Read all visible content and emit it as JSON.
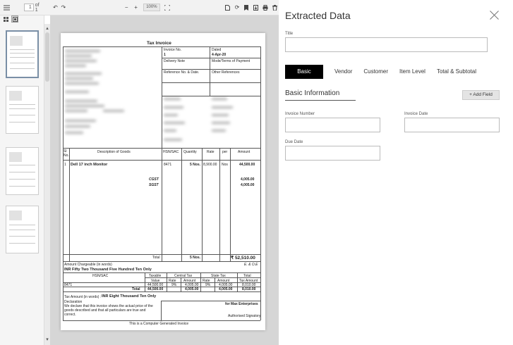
{
  "toolbar": {
    "page_current": "1",
    "page_total_text": "of 1",
    "zoom": "100%"
  },
  "document": {
    "title": "Tax Invoice",
    "header_labels": {
      "invoice_no": "Invoice No.",
      "dated": "Dated",
      "delivery_note": "Delivery Note",
      "mode_terms": "Mode/Terms of Payment",
      "reference": "Reference No. & Date.",
      "other_refs": "Other References"
    },
    "header_values": {
      "invoice_no": "1",
      "dated": "4-Apr-20"
    },
    "table": {
      "headers": [
        "Sl No.",
        "Description of Goods",
        "HSN/SAC",
        "Quantity",
        "Rate",
        "per",
        "Amount"
      ],
      "item": {
        "sl": "1",
        "description": "Dell 17 inch Monitor",
        "hsn": "8471",
        "quantity": "5 Nos.",
        "rate": "8,900.00",
        "per": "Nos",
        "amount": "44,500.00"
      },
      "cgst_label": "CGST",
      "sgst_label": "SGST",
      "cgst_amount": "4,005.00",
      "sgst_amount": "4,005.00",
      "total_label": "Total",
      "total_qty": "5 Nos.",
      "total_amount": "₹ 52,510.00"
    },
    "amount_words_label": "Amount Chargeable (in words)",
    "eoe": "E. & O.E",
    "amount_words": "INR Fifty Two Thousand Five Hundred Ten Only",
    "tax_table": {
      "hsn_label": "HSN/SAC",
      "taxable_label": "Taxable",
      "value_label": "Value",
      "central_tax": "Central Tax",
      "state_tax": "State Tax",
      "total_label": "Total",
      "tax_amount": "Tax Amount",
      "rate": "Rate",
      "amount": "Amount",
      "row": {
        "hsn": "8471",
        "value": "44,500.00",
        "c_rate": "9%",
        "c_amount": "4,005.00",
        "s_rate": "9%",
        "s_amount": "4,005.00",
        "total": "8,010.00"
      },
      "total_row": {
        "label": "Total",
        "value": "44,500.00",
        "c_amount": "4,005.00",
        "s_amount": "4,005.00",
        "total": "8,010.00"
      }
    },
    "tax_words_label": "Tax Amount (in words) :",
    "tax_words": "INR Eight Thousand Ten Only",
    "declaration_label": "Declaration",
    "declaration_text_1": "We declare that this invoice shows the actual price of the",
    "declaration_text_2": "goods described and that all particulars are true and",
    "declaration_text_3": "correct.",
    "for_company": "for Max Enterprises",
    "signatory": "Authorised Signatory",
    "footer": "This is a Computer Generated Invoice"
  },
  "panel": {
    "title": "Extracted Data",
    "title_field_label": "Title",
    "tabs": [
      "Basic",
      "Vendor",
      "Customer",
      "Item Level",
      "Total & Subtotal"
    ],
    "section_title": "Basic Information",
    "add_field": "Add Field",
    "fields": {
      "invoice_number": "Invoice Number",
      "invoice_date": "Invoice Date",
      "due_date": "Due Date"
    }
  },
  "icons": [
    "menu-icon",
    "undo-icon",
    "redo-icon",
    "zoom-out-icon",
    "zoom-in-icon",
    "fullscreen-icon",
    "file-icon",
    "rotate-icon",
    "bookmark-icon",
    "export-icon",
    "print-icon",
    "trash-icon",
    "grid-view-icon",
    "thumbnail-view-icon",
    "close-icon",
    "plus-icon"
  ]
}
